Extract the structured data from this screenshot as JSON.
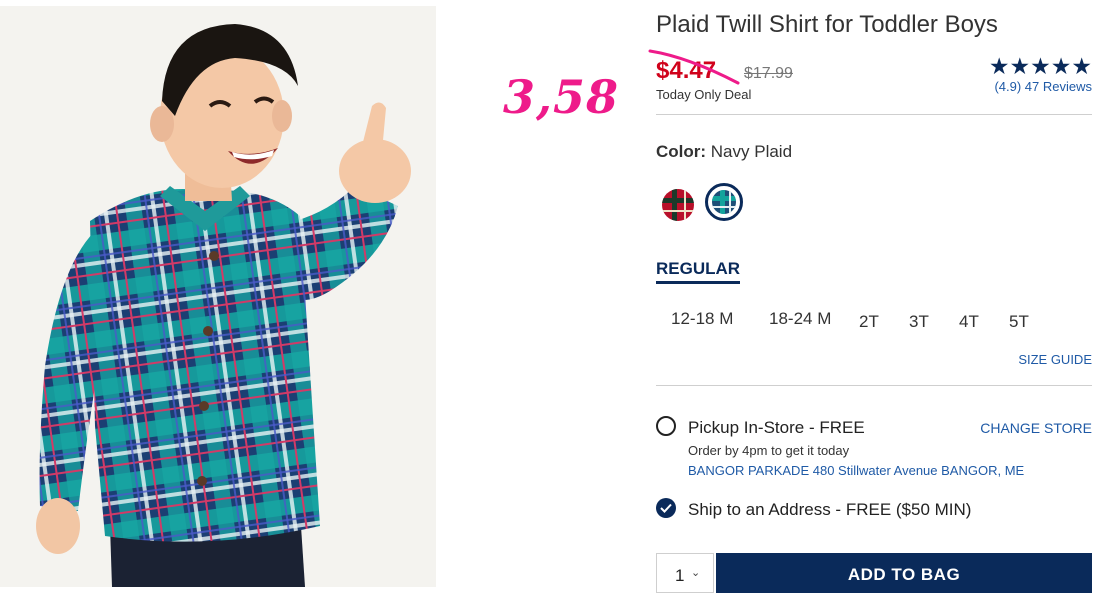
{
  "annotation": {
    "handwritten_price": "3,58"
  },
  "product": {
    "title": "Plaid Twill Shirt for Toddler Boys",
    "sale_price": "$4.47",
    "original_price": "$17.99",
    "deal_label": "Today Only Deal",
    "rating": {
      "stars": "★★★★★",
      "score_text": "(4.9) 47 Reviews",
      "value": 4.9,
      "count": 47
    }
  },
  "color": {
    "label": "Color:",
    "selected": "Navy Plaid",
    "swatches": [
      {
        "name": "red-plaid",
        "base": "#b8102a"
      },
      {
        "name": "navy-plaid",
        "base": "#1d4f77"
      }
    ]
  },
  "fit": {
    "selected_tab": "REGULAR"
  },
  "sizes": [
    "12-18 M",
    "18-24 M",
    "2T",
    "3T",
    "4T",
    "5T"
  ],
  "size_guide": "SIZE GUIDE",
  "fulfillment": {
    "pickup_label": "Pickup In-Store - FREE",
    "change_store": "CHANGE STORE",
    "pickup_note": "Order by 4pm to get it today",
    "store_address": "BANGOR PARKADE 480 Stillwater Avenue  BANGOR, ME",
    "ship_label": "Ship to an Address - FREE ($50 MIN)"
  },
  "cart": {
    "quantity": "1",
    "add_button": "ADD TO BAG"
  },
  "colors": {
    "brand_navy": "#0a2a5a",
    "sale_red": "#d0021b",
    "link_blue": "#1f5aa6",
    "annotation_pink": "#ee1b8a"
  }
}
